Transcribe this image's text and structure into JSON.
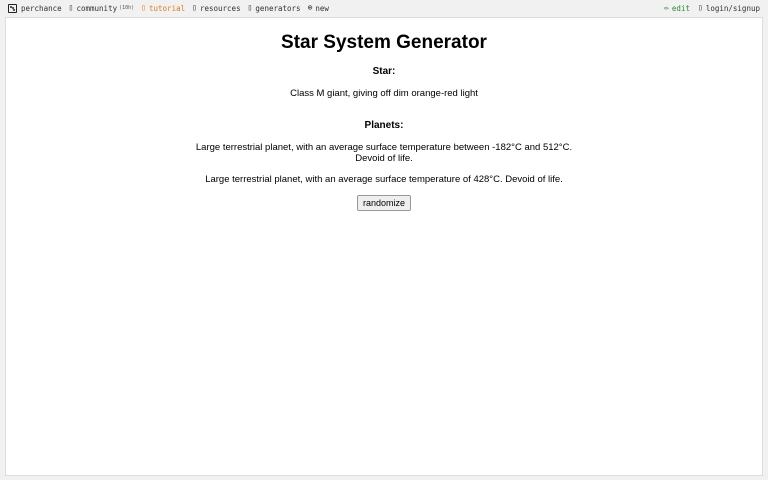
{
  "nav": {
    "brand": "perchance",
    "community": "community",
    "community_badge": "(10h)",
    "tutorial": "tutorial",
    "resources": "resources",
    "generators": "generators",
    "new": "new",
    "edit": "edit",
    "login": "login/signup",
    "icons": {
      "brand": "dice-icon",
      "community": "chat-icon",
      "tutorial": "book-icon",
      "resources": "resources-icon",
      "generators": "generators-icon",
      "new": "plus-circle-icon",
      "edit": "pencil-icon",
      "login": "user-icon"
    },
    "colors": {
      "tutorial": "#e07a1f",
      "edit": "#2f8a2f"
    }
  },
  "main": {
    "title": "Star System Generator",
    "star_label": "Star:",
    "star_description": "Class M giant, giving off dim orange-red light",
    "planets_label": "Planets:",
    "planets": [
      "Large terrestrial planet, with an average surface temperature between -182°C and 512°C. Devoid of life.",
      "Large terrestrial planet, with an average surface temperature of 428°C. Devoid of life."
    ],
    "randomize_label": "randomize"
  }
}
